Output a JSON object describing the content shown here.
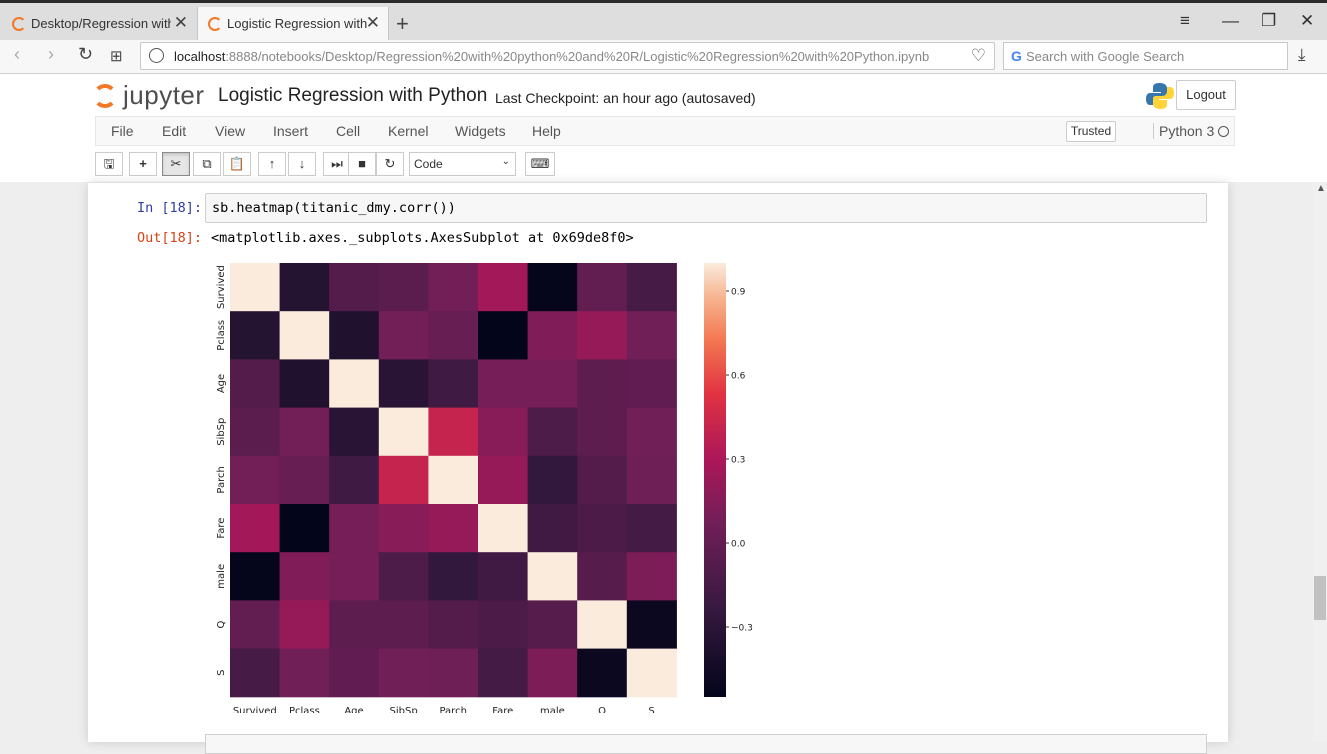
{
  "browser": {
    "tabs": [
      {
        "title": "Desktop/Regression with p",
        "active": false
      },
      {
        "title": "Logistic Regression with P",
        "active": true
      }
    ],
    "new_tab_label": "+",
    "url_host": "localhost",
    "url_rest": ":8888/notebooks/Desktop/Regression%20with%20python%20and%20R/Logistic%20Regression%20with%20Python.ipynb",
    "search_placeholder": "Search with Google Search",
    "icons": [
      "back-icon",
      "forward-icon",
      "reload-icon",
      "speed-dial-icon",
      "globe-icon",
      "heart-icon",
      "download-icon"
    ]
  },
  "jupyter": {
    "logo_text": "jupyter",
    "notebook_name": "Logistic Regression with Python",
    "checkpoint": "Last Checkpoint: an hour ago (autosaved)",
    "logout_label": "Logout",
    "menu": [
      "File",
      "Edit",
      "View",
      "Insert",
      "Cell",
      "Kernel",
      "Widgets",
      "Help"
    ],
    "trusted_label": "Trusted",
    "kernel_name": "Python 3",
    "cell_type": "Code",
    "accent_color": "#f37726"
  },
  "cell": {
    "in_prompt": "In [18]:",
    "code": "sb.heatmap(titanic_dmy.corr())",
    "out_prompt": "Out[18]:",
    "out_text": "<matplotlib.axes._subplots.AxesSubplot at 0x69de8f0>"
  },
  "chart_data": {
    "type": "heatmap",
    "labels": [
      "Survived",
      "Pclass",
      "Age",
      "SibSp",
      "Parch",
      "Fare",
      "male",
      "Q",
      "S"
    ],
    "matrix": [
      [
        1.0,
        -0.34,
        -0.08,
        -0.04,
        0.08,
        0.26,
        -0.54,
        0.0,
        -0.15
      ],
      [
        -0.34,
        1.0,
        -0.37,
        0.08,
        0.02,
        -0.55,
        0.13,
        0.22,
        0.07
      ],
      [
        -0.08,
        -0.37,
        1.0,
        -0.31,
        -0.19,
        0.09,
        0.09,
        -0.03,
        -0.01
      ],
      [
        -0.04,
        0.08,
        -0.31,
        1.0,
        0.41,
        0.16,
        -0.11,
        -0.03,
        0.07
      ],
      [
        0.08,
        0.02,
        -0.19,
        0.41,
        1.0,
        0.22,
        -0.25,
        -0.08,
        0.06
      ],
      [
        0.26,
        -0.55,
        0.09,
        0.16,
        0.22,
        1.0,
        -0.18,
        -0.12,
        -0.16
      ],
      [
        -0.54,
        0.13,
        0.09,
        -0.11,
        -0.25,
        -0.18,
        1.0,
        -0.07,
        0.12
      ],
      [
        0.0,
        0.22,
        -0.03,
        -0.03,
        -0.08,
        -0.12,
        -0.07,
        1.0,
        -0.5
      ],
      [
        -0.15,
        0.07,
        -0.01,
        0.07,
        0.06,
        -0.16,
        0.12,
        -0.5,
        1.0
      ]
    ],
    "vmin": -0.55,
    "vmax": 1.0,
    "colorbar_ticks": [
      0.9,
      0.6,
      0.3,
      0.0,
      -0.3
    ],
    "colorbar_tick_labels": [
      "0.9",
      "0.6",
      "0.3",
      "0.0",
      "−0.3"
    ],
    "colormap": "rocket",
    "title": "",
    "xlabel": "",
    "ylabel": ""
  }
}
